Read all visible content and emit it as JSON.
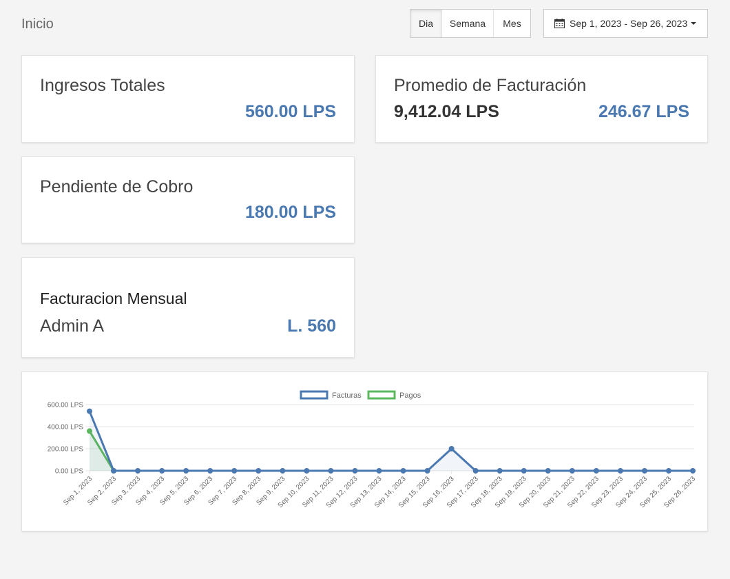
{
  "page": {
    "title": "Inicio"
  },
  "range_buttons": [
    {
      "label": "Dia",
      "active": true
    },
    {
      "label": "Semana",
      "active": false
    },
    {
      "label": "Mes",
      "active": false
    }
  ],
  "date_range": {
    "icon": "calendar-icon",
    "label": "Sep 1, 2023 - Sep 26, 2023"
  },
  "cards": {
    "ingresos": {
      "label": "Ingresos Totales",
      "value": "560.00 LPS"
    },
    "promedio": {
      "label": "Promedio de Facturación",
      "value_primary": "9,412.04 LPS",
      "value_secondary": "246.67 LPS"
    },
    "pendiente": {
      "label": "Pendiente de Cobro",
      "value": "180.00 LPS"
    },
    "facturacion": {
      "title": "Facturacion Mensual",
      "name": "Admin A",
      "value": "L. 560"
    }
  },
  "colors": {
    "accent": "#4a78b0",
    "series_facturas": "#4a78b0",
    "series_pagos": "#5cb85c"
  },
  "chart_data": {
    "type": "line",
    "title": "",
    "xlabel": "",
    "ylabel": "",
    "ylim": [
      0,
      600
    ],
    "y_ticks": [
      "0.00 LPS",
      "200.00 LPS",
      "400.00 LPS",
      "600.00 LPS"
    ],
    "y_tick_values": [
      0,
      200,
      400,
      600
    ],
    "legend_position": "top",
    "grid": true,
    "categories": [
      "Sep 1, 2023",
      "Sep 2, 2023",
      "Sep 3, 2023",
      "Sep 4, 2023",
      "Sep 5, 2023",
      "Sep 6, 2023",
      "Sep 7, 2023",
      "Sep 8, 2023",
      "Sep 9, 2023",
      "Sep 10, 2023",
      "Sep 11, 2023",
      "Sep 12, 2023",
      "Sep 13, 2023",
      "Sep 14, 2023",
      "Sep 15, 2023",
      "Sep 16, 2023",
      "Sep 17, 2023",
      "Sep 18, 2023",
      "Sep 19, 2023",
      "Sep 20, 2023",
      "Sep 21, 2023",
      "Sep 22, 2023",
      "Sep 23, 2023",
      "Sep 24, 2023",
      "Sep 25, 2023",
      "Sep 26, 2023"
    ],
    "series": [
      {
        "name": "Facturas",
        "color": "#4a78b0",
        "values": [
          540,
          0,
          0,
          0,
          0,
          0,
          0,
          0,
          0,
          0,
          0,
          0,
          0,
          0,
          0,
          200,
          0,
          0,
          0,
          0,
          0,
          0,
          0,
          0,
          0,
          0
        ]
      },
      {
        "name": "Pagos",
        "color": "#5cb85c",
        "values": [
          360,
          0
        ]
      }
    ]
  }
}
